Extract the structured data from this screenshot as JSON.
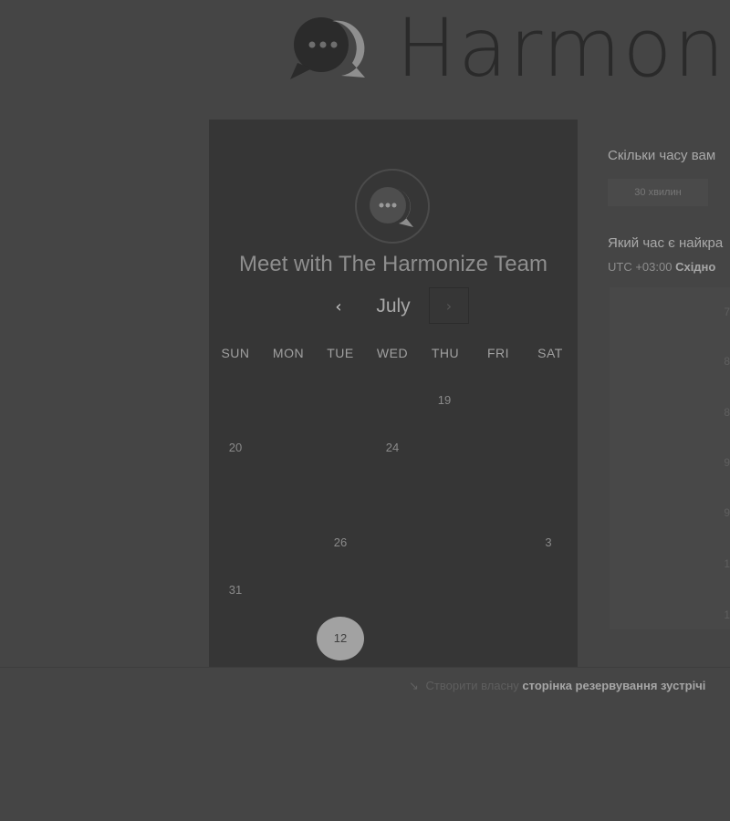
{
  "header": {
    "brand_name": "Harmon"
  },
  "calendar": {
    "title": "Meet with The Harmonize Team",
    "month": "July",
    "prev_label": "‹",
    "next_label": "›",
    "weekdays": [
      "SUN",
      "MON",
      "TUE",
      "WED",
      "THU",
      "FRI",
      "SAT"
    ],
    "days": {
      "d19": "19",
      "d20": "20",
      "d24": "24",
      "d26": "26",
      "d3": "3",
      "d31": "31",
      "selected": "12"
    }
  },
  "booking": {
    "duration_question": "Скільки часу вам",
    "duration_option": "30 хвилин",
    "time_question": "Який час є найкра",
    "timezone_offset": "UTC +03:00",
    "timezone_name": "Східно",
    "slots": [
      "7",
      "8",
      "8",
      "9",
      "9",
      "1",
      "1"
    ]
  },
  "footer": {
    "icon": "↘",
    "prefix": "Створити власну",
    "link": "сторінка резервування зустрічі"
  },
  "colors": {
    "background": "#454545",
    "card": "#363636",
    "selected_day": "#a2a2a2"
  }
}
